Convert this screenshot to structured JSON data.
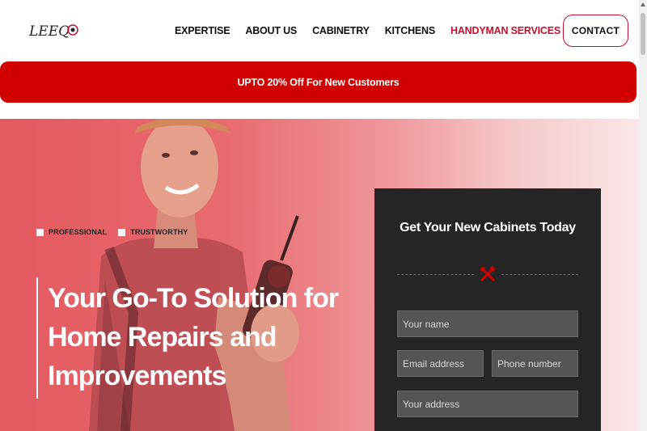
{
  "header": {
    "logo_text": "LEEQ",
    "nav": [
      {
        "label": "EXPERTISE"
      },
      {
        "label": "ABOUT US"
      },
      {
        "label": "CABINETRY"
      },
      {
        "label": "KITCHENS"
      },
      {
        "label": "HANDYMAN SERVICES",
        "active": true
      }
    ],
    "contact_label": "CONTACT"
  },
  "promo": {
    "text": "UPTO 20% Off For New Customers"
  },
  "hero": {
    "tags": [
      "PROFESSIONAL",
      "TRUSTWORTHY"
    ],
    "title_lines": [
      "Your Go-To Solution for",
      "Home Repairs and",
      "Improvements"
    ]
  },
  "form": {
    "title": "Get Your New Cabinets Today",
    "fields": {
      "name_placeholder": "Your name",
      "email_placeholder": "Email address",
      "phone_placeholder": "Phone number",
      "address_placeholder": "Your address"
    }
  },
  "colors": {
    "brand_red": "#c8102e",
    "promo_red": "#d00000",
    "card_bg": "#252525",
    "field_bg": "#555555"
  },
  "icons": [
    "logo",
    "tools-icon",
    "checkbox-icon"
  ]
}
